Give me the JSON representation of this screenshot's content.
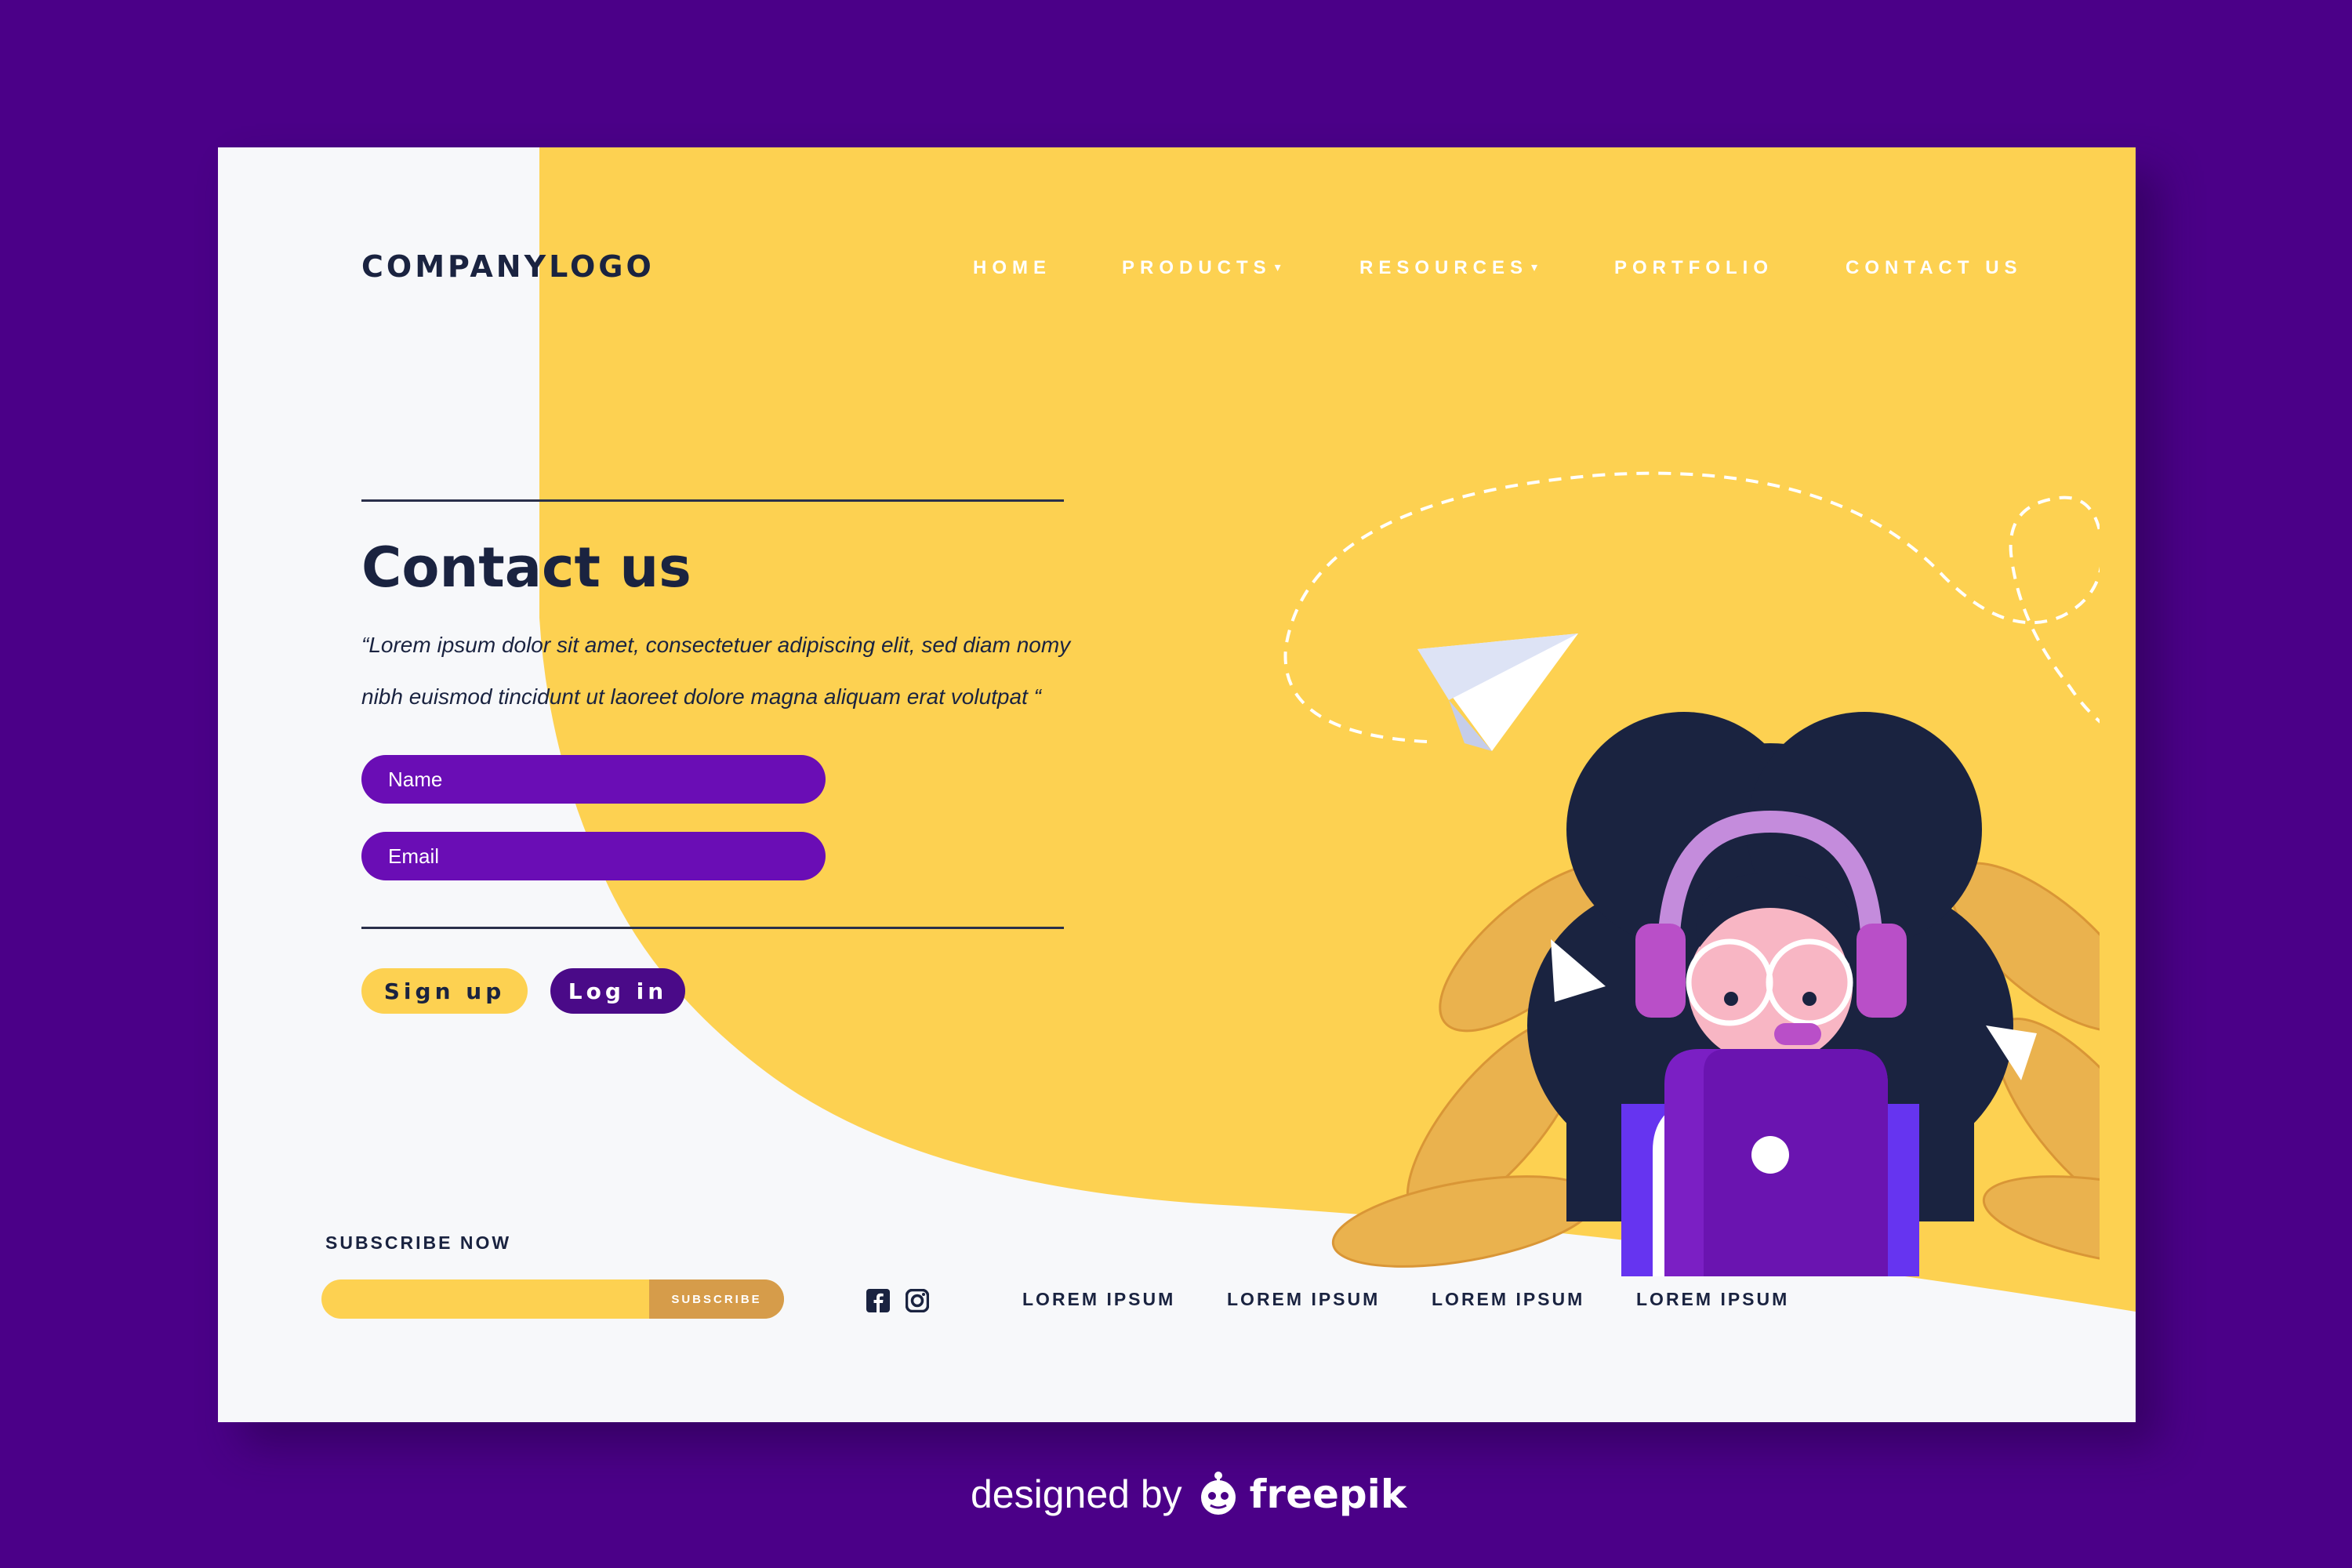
{
  "brand": {
    "name_part1": "COMPANY",
    "name_part2": "LOGO"
  },
  "nav": {
    "items": [
      {
        "label": "HOME",
        "caret": ""
      },
      {
        "label": "PRODUCTS",
        "caret": "▾"
      },
      {
        "label": "RESOURCES",
        "caret": "▾"
      },
      {
        "label": "PORTFOLIO",
        "caret": ""
      },
      {
        "label": "CONTACT US",
        "caret": ""
      }
    ]
  },
  "hero": {
    "title": "Contact us",
    "quote_line1": "“Lorem ipsum dolor sit amet, consectetuer adipiscing elit, sed diam nomy",
    "quote_line2": "nibh euismod tincidunt ut laoreet dolore magna aliquam erat volutpat “"
  },
  "form": {
    "name_placeholder": "Name",
    "email_placeholder": "Email",
    "signup_label": "Sign up",
    "login_label": "Log in"
  },
  "footer": {
    "subscribe_title": "SUBSCRIBE NOW",
    "subscribe_button": "SUBSCRIBE",
    "links": [
      "LOREM IPSUM",
      "LOREM IPSUM",
      "LOREM IPSUM",
      "LOREM IPSUM"
    ],
    "social_icons": [
      "facebook-icon",
      "instagram-icon"
    ]
  },
  "credit": {
    "prefix": "designed by",
    "brand": "freepik"
  },
  "colors": {
    "page_background": "#4b0088",
    "accent_yellow": "#fdd151",
    "accent_purple": "#6a0db5",
    "text_dark": "#1a2340",
    "subscribe_button": "#d69c4a"
  }
}
